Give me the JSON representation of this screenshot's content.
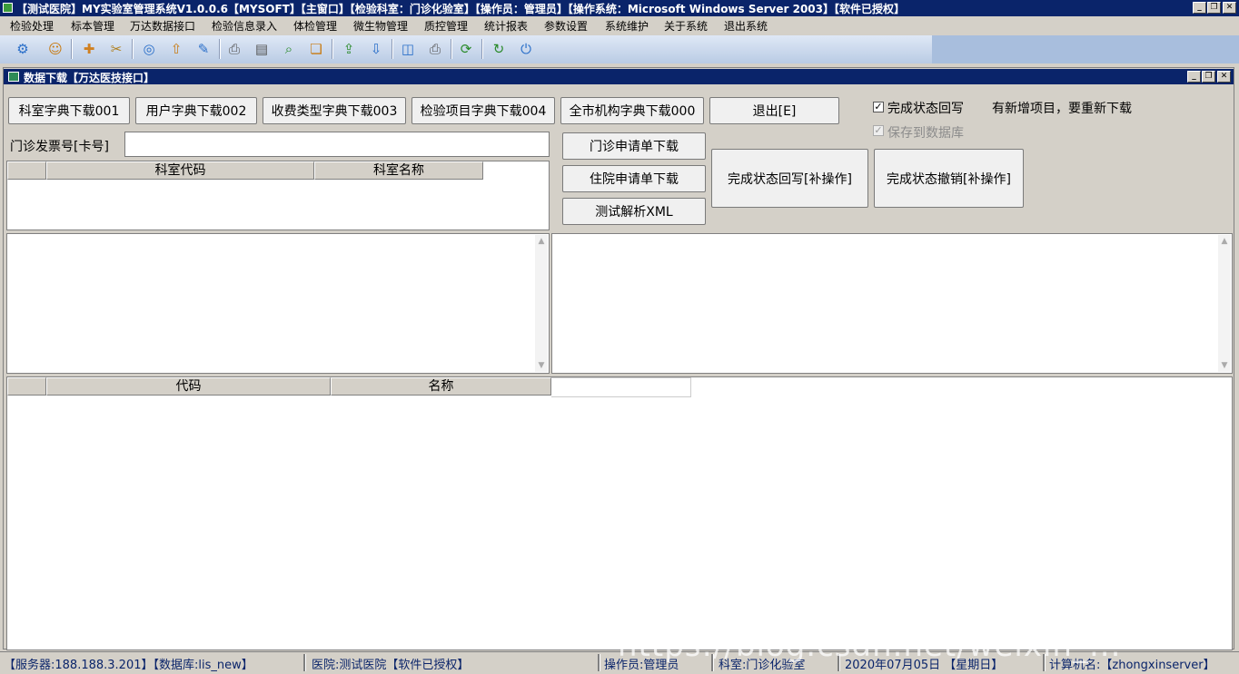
{
  "window": {
    "title": "【测试医院】MY实验室管理系统V1.0.0.6【MYSOFT】【主窗口】【检验科室：门诊化验室】【操作员：管理员】【操作系统：Microsoft Windows Server 2003】【软件已授权】",
    "minimize": "_",
    "restore": "❐",
    "close": "✕"
  },
  "menu": {
    "items": [
      "检验处理",
      "标本管理",
      "万达数据接口",
      "检验信息录入",
      "体检管理",
      "微生物管理",
      "质控管理",
      "统计报表",
      "参数设置",
      "系统维护",
      "关于系统",
      "退出系统"
    ]
  },
  "toolbar": {
    "icons": [
      "settings-icon",
      "user-icon",
      "new-doc-icon",
      "tools-icon",
      "globe-icon",
      "upload-icon",
      "edit-icon",
      "print-icon",
      "print-preview-icon",
      "find-icon",
      "copy-icon",
      "export-icon",
      "import-icon",
      "preview-icon",
      "printer-icon",
      "refresh-icon",
      "sync-icon",
      "power-icon"
    ],
    "glyphs": [
      "⚙",
      "☺",
      "✚",
      "✂",
      "◎",
      "⇧",
      "✎",
      "⎙",
      "▤",
      "⌕",
      "❏",
      "⇪",
      "⇩",
      "◫",
      "⎙",
      "⟳",
      "↻",
      "⏻"
    ]
  },
  "child": {
    "title": "数据下载【万达医技接口】",
    "minimize": "_",
    "restore": "❐",
    "close": "✕"
  },
  "buttons": {
    "dept_dict": "科室字典下载001",
    "user_dict": "用户字典下载002",
    "fee_dict": "收费类型字典下载003",
    "item_dict": "检验项目字典下载004",
    "org_dict": "全市机构字典下载000",
    "exit": "退出[E]",
    "outpatient_download": "门诊申请单下载",
    "inpatient_download": "住院申请单下载",
    "test_xml": "测试解析XML",
    "status_write": "完成状态回写[补操作]",
    "status_cancel": "完成状态撤销[补操作]"
  },
  "options": {
    "status_writeback": "完成状态回写",
    "status_writeback_checked": true,
    "new_items_note": "有新增项目，要重新下载",
    "save_db": "保存到数据库",
    "save_db_checked": true
  },
  "invoice": {
    "label": "门诊发票号[卡号]",
    "value": ""
  },
  "dept_grid": {
    "headers": [
      "科室代码",
      "科室名称"
    ]
  },
  "bottom_grid": {
    "headers": [
      "代码",
      "名称"
    ]
  },
  "status": {
    "server": "【服务器:188.188.3.201】【数据库:lis_new】",
    "hospital": "医院:测试医院【软件已授权】",
    "operator": "操作员:管理员",
    "dept": "科室:门诊化验室",
    "date": "2020年07月05日 【星期日】",
    "computer": "计算机名:【zhongxinserver】"
  },
  "watermark": "https://blog.csdn.net/weixin_..."
}
